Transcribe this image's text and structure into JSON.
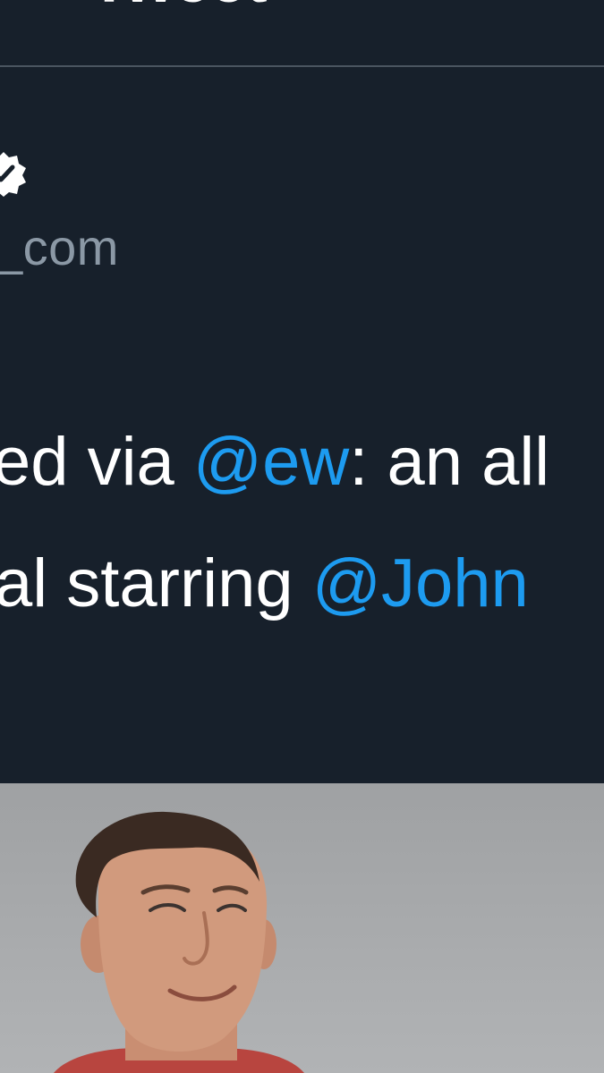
{
  "header": {
    "title": "Tweet"
  },
  "author": {
    "handle": "_com",
    "verified_icon": "verified-badge-icon"
  },
  "tweet": {
    "line1_prefix": "ed via ",
    "line1_mention": "@ew",
    "line1_suffix": ": an all",
    "line2_prefix": "al starring ",
    "line2_mention": "@John"
  },
  "colors": {
    "background": "#17202b",
    "mention": "#1d9bf0",
    "secondary_text": "#8b98a5",
    "divider": "#4a5560"
  },
  "media": {
    "kind": "photo"
  }
}
